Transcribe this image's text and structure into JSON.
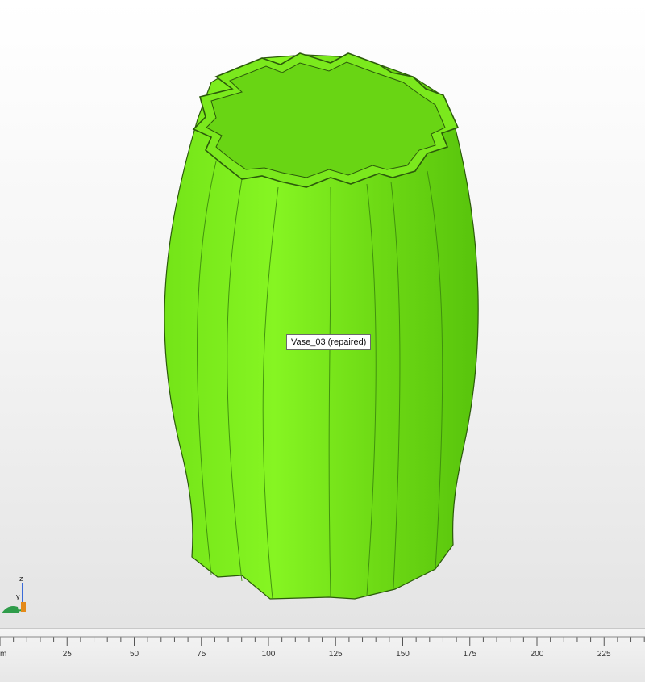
{
  "viewport": {
    "object_label": "Vase_03 (repaired)",
    "model_color": "#80f21c",
    "model_shadow_color": "#57c40c",
    "model_edge_color": "#2c5a0b",
    "background_color": "#f3f3f3"
  },
  "axis_indicator": {
    "z_label": "z",
    "y_label": "y"
  },
  "ruler": {
    "unit_label": "m",
    "ticks": [
      {
        "value": 25,
        "label": "25"
      },
      {
        "value": 50,
        "label": "50"
      },
      {
        "value": 75,
        "label": "75"
      },
      {
        "value": 100,
        "label": "100"
      },
      {
        "value": 125,
        "label": "125"
      },
      {
        "value": 150,
        "label": "150"
      },
      {
        "value": 175,
        "label": "175"
      },
      {
        "value": 200,
        "label": "200"
      },
      {
        "value": 225,
        "label": "225"
      }
    ]
  }
}
